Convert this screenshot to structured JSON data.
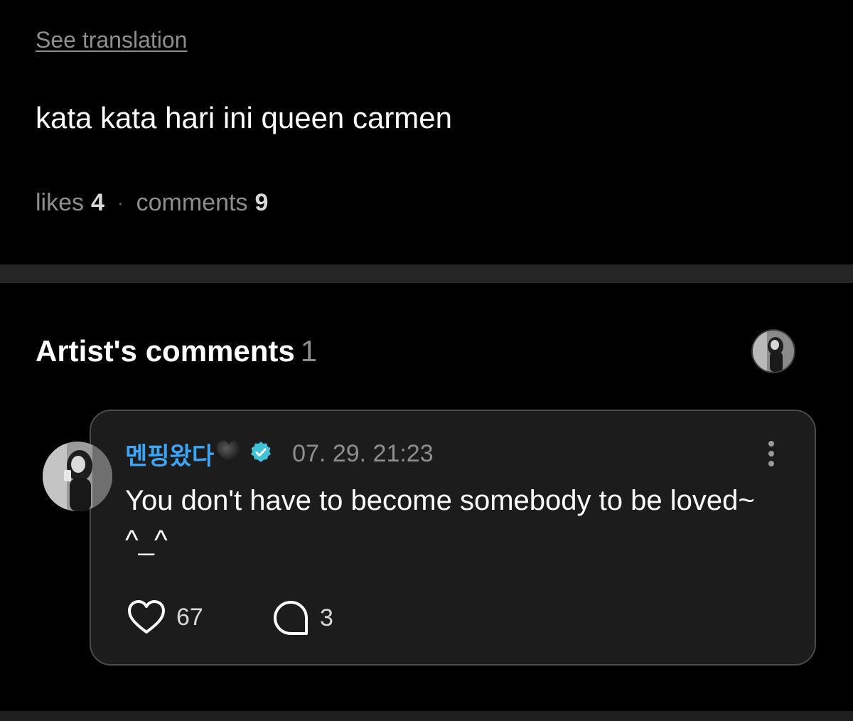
{
  "post": {
    "see_translation": "See translation",
    "text": "kata kata hari ini queen carmen",
    "likes_label": "likes",
    "likes_count": "4",
    "separator": "·",
    "comments_label": "comments",
    "comments_count": "9"
  },
  "artist_comments": {
    "title": "Artist's comments",
    "count": "1",
    "comment": {
      "author": "멘핑왔다",
      "author_emoji": "black-heart-icon",
      "verified": true,
      "timestamp": "07. 29. 21:23",
      "text": "You don't have to become somebody to be loved~ ^_^",
      "like_count": "67",
      "reply_count": "3"
    }
  },
  "icons": {
    "more": "more-vertical-icon",
    "like": "heart-outline-icon",
    "reply": "speech-bubble-icon",
    "verified": "verified-badge-icon"
  },
  "colors": {
    "background": "#000000",
    "divider": "#262626",
    "card_background": "#1c1c1c",
    "card_border": "#4a4a4a",
    "author_name": "#3da5f5",
    "verified_badge": "#3fc1d6",
    "muted_text": "#8e8e8e"
  }
}
